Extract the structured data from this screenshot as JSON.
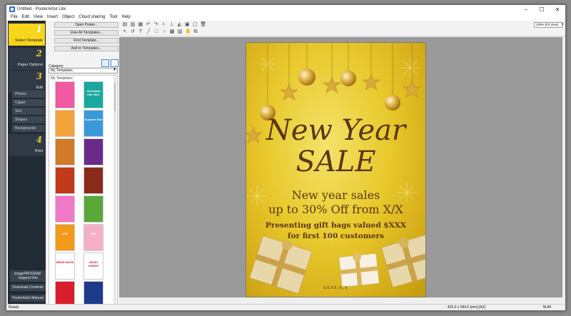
{
  "window": {
    "title": "Untitled - PosterArtist Lite",
    "buttons": [
      "–",
      "☐",
      "✕"
    ]
  },
  "menu": [
    "File",
    "Edit",
    "View",
    "Insert",
    "Object",
    "Cloud sharing",
    "Tool",
    "Help"
  ],
  "steps": [
    {
      "num": "1",
      "label": "Select Template"
    },
    {
      "num": "2",
      "label": "Paper Options"
    },
    {
      "num": "3",
      "label": "Edit"
    },
    {
      "num": "4",
      "label": "Print"
    }
  ],
  "edit_subitems": [
    "Photos",
    "Clipart",
    "Text",
    "Shapes",
    "Backgrounds"
  ],
  "bottom_links": [
    "imagePROGRAF Support Info",
    "Download Contents",
    "PosterArtist Manual"
  ],
  "template_panel": {
    "buttons": [
      "Open Poster...",
      "View All Templates...",
      "Find Template...",
      "Add to Templates..."
    ],
    "category_label": "Category:",
    "category_value": "My Templates",
    "list_header": "My Templates",
    "thumbs": [
      {
        "bg": "#ef5aa0",
        "text": ""
      },
      {
        "bg": "#1aa8a0",
        "text": "Christmas Fair 2021"
      },
      {
        "bg": "#f2a23a",
        "text": ""
      },
      {
        "bg": "#3a9ad9",
        "text": "Summer Fair"
      },
      {
        "bg": "#d07a2a",
        "text": ""
      },
      {
        "bg": "#6a2a8a",
        "text": ""
      },
      {
        "bg": "#c23a1a",
        "text": ""
      },
      {
        "bg": "#8a2a1a",
        "text": ""
      },
      {
        "bg": "#f07ac8",
        "text": ""
      },
      {
        "bg": "#5aa83a",
        "text": ""
      },
      {
        "bg": "#f29a1a",
        "text": "20%"
      },
      {
        "bg": "#f5b0c8",
        "text": "15%"
      },
      {
        "bg": "#ffffff",
        "text": "WEAR MASK"
      },
      {
        "bg": "#ffffff",
        "text": "WASH HANDS"
      },
      {
        "bg": "#d81e2a",
        "text": ""
      },
      {
        "bg": "#1e3a8a",
        "text": ""
      }
    ]
  },
  "toolbar": {
    "zoom_value": "100% (Fit View)"
  },
  "poster": {
    "line1": "New Year",
    "line2": "SALE",
    "body1": "New year sales",
    "body2": "up to 30% Off from X/X",
    "body3": "Presenting gift bags valued $XXX",
    "body4": "for first 100 customers",
    "footer": "XXXX/X/X",
    "colors": {
      "gold": "#e8c92c",
      "text": "#5b3512"
    }
  },
  "status": {
    "left": "Ready",
    "size": "420.0 x 594.0 [mm] [A2]",
    "num": "NUM"
  }
}
